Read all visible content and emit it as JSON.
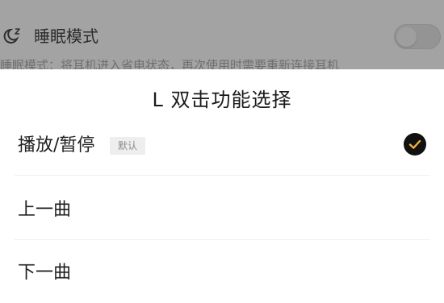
{
  "background_page": {
    "setting_label": "睡眠模式",
    "setting_desc": "睡眠模式：将耳机进入省电状态，再次使用时需要重新连接耳机",
    "toggle_state": "off"
  },
  "sheet": {
    "title": "L 双击功能选择",
    "options": [
      {
        "label": "播放/暂停",
        "badge": "默认",
        "selected": true
      },
      {
        "label": "上一曲",
        "selected": false
      },
      {
        "label": "下一曲",
        "selected": false
      }
    ]
  },
  "colors": {
    "overlay_dim": "#a3a3a3",
    "check_bg": "#111111",
    "check_mark": "#f2b233"
  }
}
